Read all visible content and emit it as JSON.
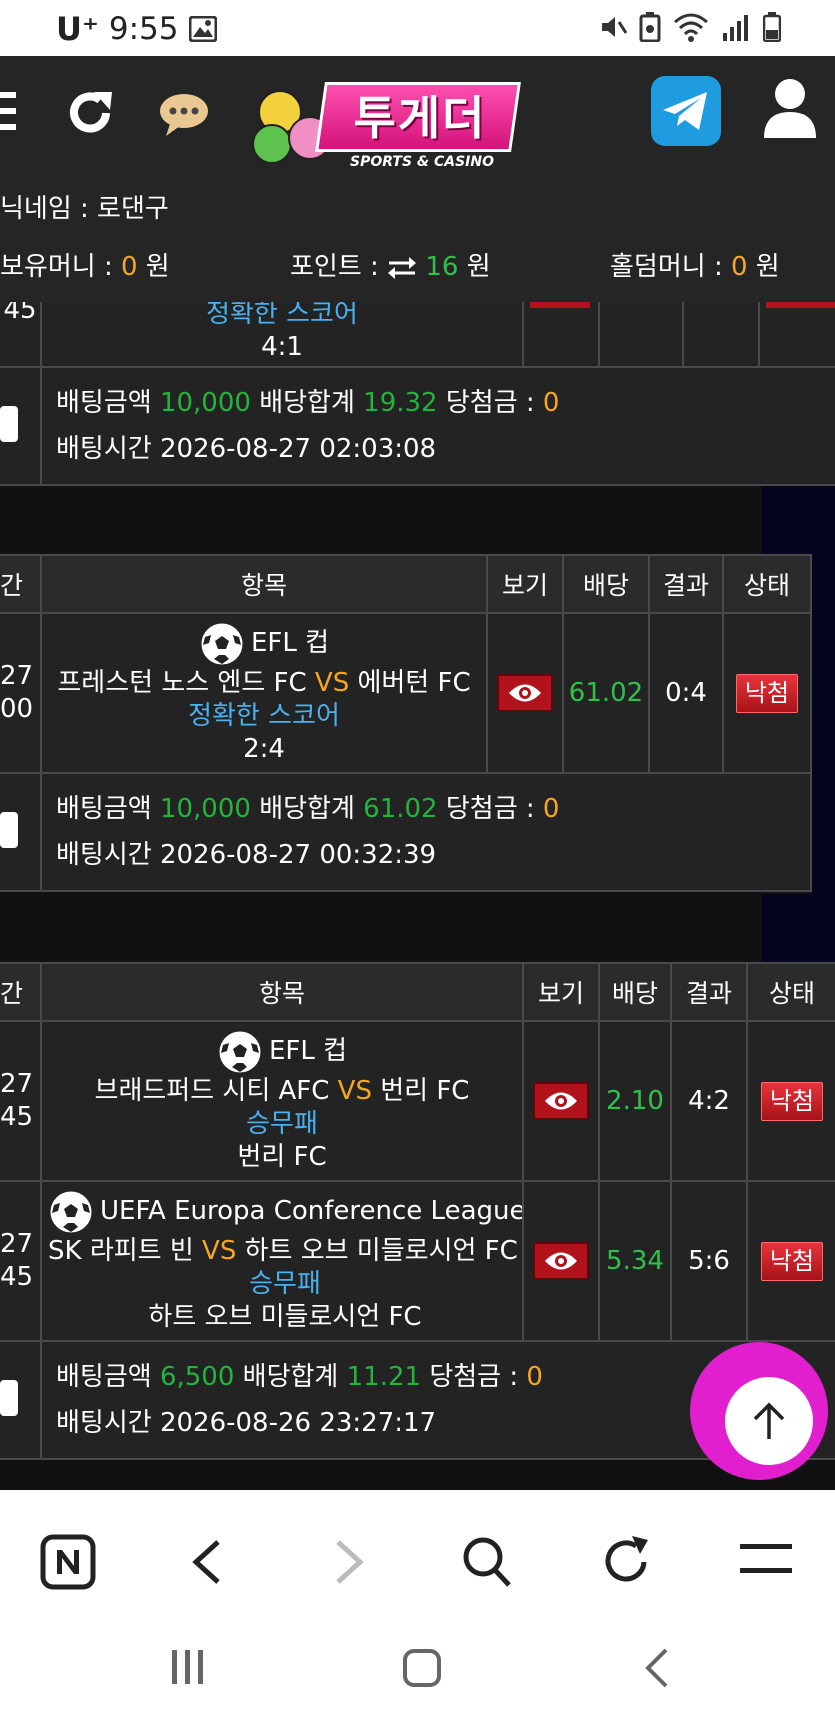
{
  "status_bar": {
    "carrier": "U⁺",
    "time": "9:55"
  },
  "header": {
    "logo_text": "투게더",
    "logo_sub": "SPORTS & CASINO",
    "nickname_label": "닉네임 : 로댄구",
    "money_label": "보유머니 :",
    "money_value": "0",
    "money_unit": "원",
    "points_label": "포인트 :",
    "points_value": "16",
    "points_unit": "원",
    "holdem_label": "홀덤머니 :",
    "holdem_value": "0",
    "holdem_unit": "원"
  },
  "labels": {
    "bet_amount": "배팅금액",
    "odds_total": "배당합계",
    "win_amount": "당첨금 :",
    "bet_time": "배팅시간",
    "vs": "VS"
  },
  "columns": [
    "간",
    "항목",
    "보기",
    "배당",
    "결과",
    "상태"
  ],
  "bet0": {
    "partial_time": "45",
    "bet_type": "정확한 스코어",
    "pick": "4:1",
    "amount": "10,000",
    "odds_total": "19.32",
    "win": "0",
    "time": "2026-08-27 02:03:08"
  },
  "bet1": {
    "league": "EFL 컵",
    "time_top": "27",
    "time_bottom": "00",
    "home": "프레스턴 노스 엔드 FC",
    "away": "에버턴 FC",
    "bet_type": "정확한 스코어",
    "pick": "2:4",
    "odds": "61.02",
    "result": "0:4",
    "status": "낙첨",
    "amount": "10,000",
    "odds_total": "61.02",
    "win": "0",
    "bet_time": "2026-08-27 00:32:39"
  },
  "bet2": {
    "rows": [
      {
        "league": "EFL 컵",
        "time_top": "27",
        "time_bottom": "45",
        "home": "브래드퍼드 시티 AFC",
        "away": "번리 FC",
        "bet_type": "승무패",
        "pick": "번리 FC",
        "odds": "2.10",
        "result": "4:2",
        "status": "낙첨"
      },
      {
        "league": "UEFA Europa Conference League",
        "time_top": "27",
        "time_bottom": "45",
        "home": "SK 라피트 빈",
        "away": "하트 오브 미들로시언 FC",
        "bet_type": "승무패",
        "pick": "하트 오브 미들로시언 FC",
        "odds": "5.34",
        "result": "5:6",
        "status": "낙첨"
      }
    ],
    "amount": "6,500",
    "odds_total": "11.21",
    "win": "0",
    "bet_time": "2026-08-26 23:27:17"
  },
  "icons": [
    "menu-icon",
    "refresh-icon",
    "chat-icon",
    "telegram-icon",
    "user-icon",
    "eye-icon",
    "soccer-ball-icon",
    "arrow-up-icon"
  ]
}
